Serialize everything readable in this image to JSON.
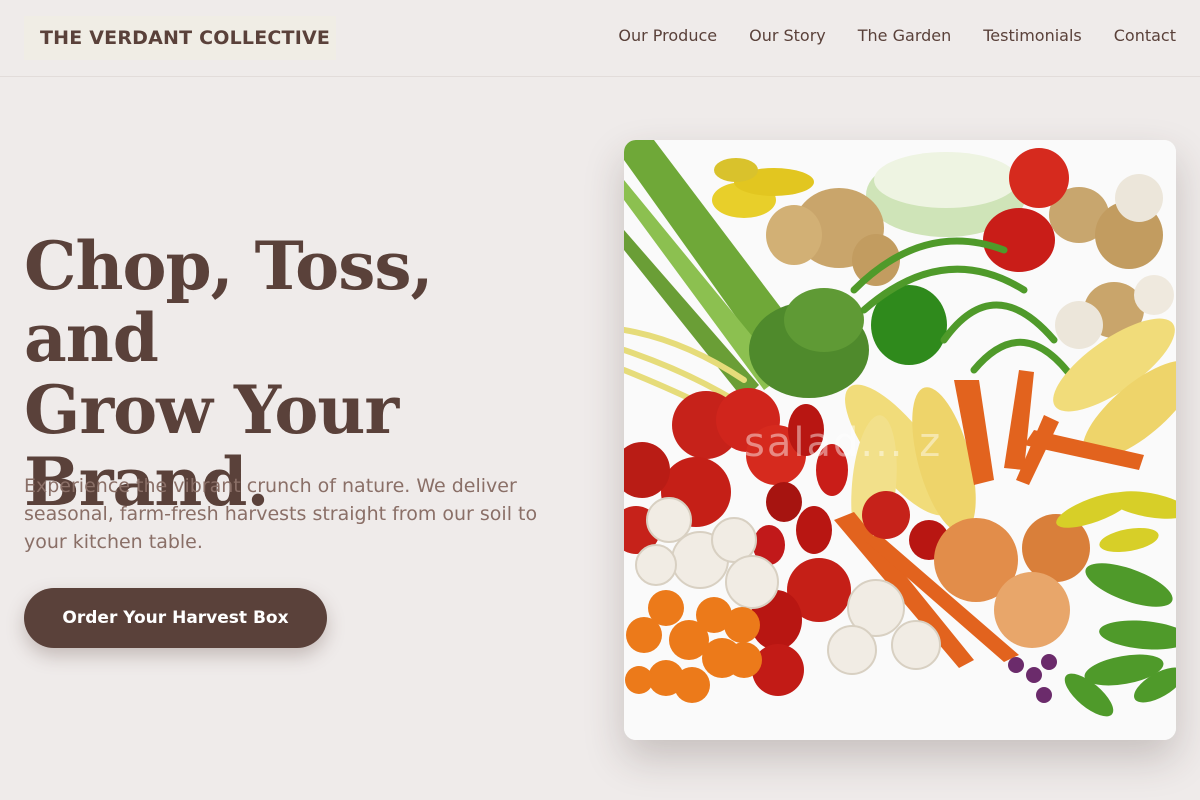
{
  "brand": {
    "name": "THE VERDANT COLLECTIVE"
  },
  "nav": {
    "items": [
      {
        "label": "Our Produce"
      },
      {
        "label": "Our Story"
      },
      {
        "label": "The Garden"
      },
      {
        "label": "Testimonials"
      },
      {
        "label": "Contact"
      }
    ]
  },
  "hero": {
    "title_line1": "Chop, Toss, and",
    "title_line2": "Grow Your",
    "title_line3": "Brand.",
    "subtitle": "Experience the vibrant crunch of nature. We deliver seasonal, farm-fresh harvests straight from our soil to your kitchen table.",
    "cta_label": "Order Your Harvest Box",
    "watermark": "salad... z"
  },
  "colors": {
    "background": "#efebea",
    "primary": "#5a413a",
    "subtitle": "#8a6f67",
    "logo_bg": "#f0ede5"
  }
}
